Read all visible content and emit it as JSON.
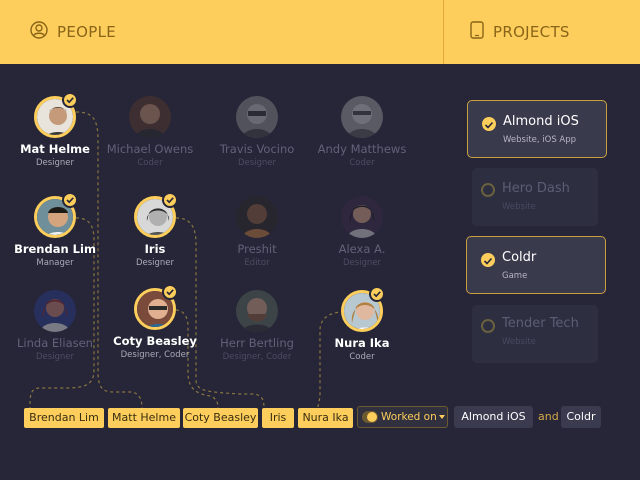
{
  "header": {
    "people_label": "PEOPLE",
    "projects_label": "PROJECTS"
  },
  "people": [
    {
      "name": "Mat Helme",
      "role": "Designer",
      "selected": true
    },
    {
      "name": "Michael Owens",
      "role": "Coder",
      "selected": false
    },
    {
      "name": "Travis Vocino",
      "role": "Designer",
      "selected": false
    },
    {
      "name": "Andy Matthews",
      "role": "Coder",
      "selected": false
    },
    {
      "name": "Brendan Lim",
      "role": "Manager",
      "selected": true
    },
    {
      "name": "Iris",
      "role": "Designer",
      "selected": true
    },
    {
      "name": "Preshit",
      "role": "Editor",
      "selected": false
    },
    {
      "name": "Alexa A.",
      "role": "Designer",
      "selected": false
    },
    {
      "name": "Linda Eliasen",
      "role": "Designer",
      "selected": false
    },
    {
      "name": "Coty Beasley",
      "role": "Designer, Coder",
      "selected": true
    },
    {
      "name": "Herr Bertling",
      "role": "Designer, Coder",
      "selected": false
    },
    {
      "name": "Nura Ika",
      "role": "Coder",
      "selected": true
    }
  ],
  "projects": [
    {
      "title": "Almond iOS",
      "subtitle": "Website, iOS App",
      "selected": true
    },
    {
      "title": "Hero Dash",
      "subtitle": "Website",
      "selected": false
    },
    {
      "title": "Coldr",
      "subtitle": "Game",
      "selected": true
    },
    {
      "title": "Tender Tech",
      "subtitle": "Website",
      "selected": false
    }
  ],
  "query": {
    "people_chips": [
      "Brendan Lim",
      "Matt Helme",
      "Coty Beasley",
      "Iris",
      "Nura Ika"
    ],
    "relation_label": "Worked  on",
    "project_chips": [
      "Almond iOS",
      "Coldr"
    ],
    "conjunction": "and"
  },
  "colors": {
    "accent": "#fdce5b",
    "background": "#262638",
    "card": "#3a3a4d"
  }
}
